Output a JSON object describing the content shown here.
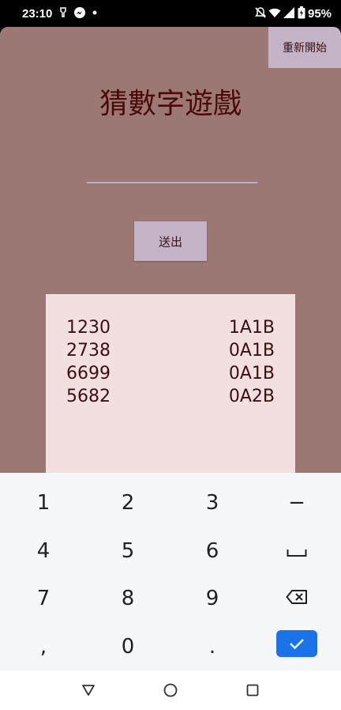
{
  "status_bar": {
    "time": "23:10",
    "battery": "95%",
    "icons": [
      "usb-icon",
      "messenger-icon",
      "dot-icon",
      "mute-icon",
      "wifi-icon",
      "signal-icon",
      "battery-icon"
    ]
  },
  "app": {
    "restart_label": "重新開始",
    "title": "猜數字遊戲",
    "input_value": "",
    "submit_label": "送出",
    "history": [
      {
        "guess": "1230",
        "result": "1A1B"
      },
      {
        "guess": "2738",
        "result": "0A1B"
      },
      {
        "guess": "6699",
        "result": "0A1B"
      },
      {
        "guess": "5682",
        "result": "0A2B"
      }
    ],
    "colors": {
      "background": "#9c7874",
      "button": "#c5b3c7",
      "history_panel": "#f2dfe0",
      "text": "#3a1010"
    }
  },
  "keyboard": {
    "keys": [
      [
        "1",
        "2",
        "3",
        "−"
      ],
      [
        "4",
        "5",
        "6",
        "space-icon"
      ],
      [
        "7",
        "8",
        "9",
        "backspace-icon"
      ],
      [
        ",",
        "0",
        ".",
        "check-icon"
      ]
    ],
    "labels": {
      "k1": "1",
      "k2": "2",
      "k3": "3",
      "minus": "−",
      "k4": "4",
      "k5": "5",
      "k6": "6",
      "k7": "7",
      "k8": "8",
      "k9": "9",
      "comma": ",",
      "k0": "0",
      "period": "."
    },
    "confirm_color": "#1a73e8"
  },
  "nav_bar": {
    "buttons": [
      "back-icon",
      "home-icon",
      "recents-icon"
    ]
  }
}
